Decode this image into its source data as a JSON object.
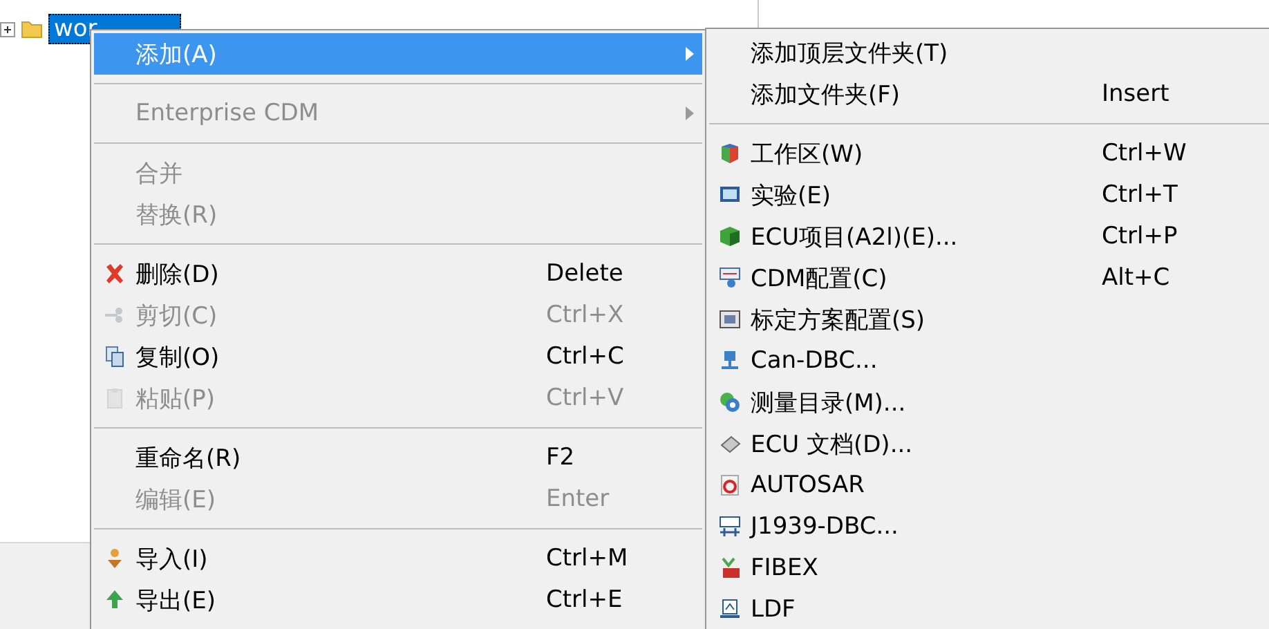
{
  "tree": {
    "items": [
      {
        "label": "wor",
        "selected": true,
        "expanded": false
      }
    ]
  },
  "context_menu": {
    "items": [
      {
        "kind": "item",
        "label": "添加(A)",
        "selected": true,
        "disabled": false,
        "submenu": true
      },
      {
        "kind": "separator"
      },
      {
        "kind": "item",
        "label": "Enterprise CDM",
        "selected": false,
        "disabled": true,
        "submenu": true
      },
      {
        "kind": "separator"
      },
      {
        "kind": "item",
        "label": "合并",
        "selected": false,
        "disabled": true,
        "submenu": false
      },
      {
        "kind": "item",
        "label": "替换(R)",
        "selected": false,
        "disabled": true,
        "submenu": false
      },
      {
        "kind": "separator"
      },
      {
        "kind": "item",
        "label": "删除(D)",
        "shortcut": "Delete",
        "selected": false,
        "disabled": false,
        "submenu": false
      },
      {
        "kind": "item",
        "label": "剪切(C)",
        "shortcut": "Ctrl+X",
        "selected": false,
        "disabled": true,
        "submenu": false
      },
      {
        "kind": "item",
        "label": "复制(O)",
        "shortcut": "Ctrl+C",
        "selected": false,
        "disabled": false,
        "submenu": false
      },
      {
        "kind": "item",
        "label": "粘贴(P)",
        "shortcut": "Ctrl+V",
        "selected": false,
        "disabled": true,
        "submenu": false
      },
      {
        "kind": "separator"
      },
      {
        "kind": "item",
        "label": "重命名(R)",
        "shortcut": "F2",
        "selected": false,
        "disabled": false,
        "submenu": false
      },
      {
        "kind": "item",
        "label": "编辑(E)",
        "shortcut": "Enter",
        "selected": false,
        "disabled": true,
        "submenu": false
      },
      {
        "kind": "separator"
      },
      {
        "kind": "item",
        "label": "导入(I)",
        "shortcut": "Ctrl+M",
        "selected": false,
        "disabled": false,
        "submenu": false
      },
      {
        "kind": "item",
        "label": "导出(E)",
        "shortcut": "Ctrl+E",
        "selected": false,
        "disabled": false,
        "submenu": false
      }
    ]
  },
  "submenu": {
    "items": [
      {
        "kind": "item",
        "label": "添加顶层文件夹(T)",
        "selected": false,
        "disabled": false
      },
      {
        "kind": "item",
        "label": "添加文件夹(F)",
        "shortcut": "Insert",
        "selected": false,
        "disabled": false
      },
      {
        "kind": "separator"
      },
      {
        "kind": "item",
        "label": "工作区(W)",
        "shortcut": "Ctrl+W",
        "selected": false,
        "disabled": false
      },
      {
        "kind": "item",
        "label": "实验(E)",
        "shortcut": "Ctrl+T",
        "selected": false,
        "disabled": false
      },
      {
        "kind": "item",
        "label": "ECU项目(A2l)(E)...",
        "shortcut": "Ctrl+P",
        "selected": false,
        "disabled": false
      },
      {
        "kind": "item",
        "label": "CDM配置(C)",
        "shortcut": "Alt+C",
        "selected": false,
        "disabled": false
      },
      {
        "kind": "item",
        "label": "标定方案配置(S)",
        "selected": false,
        "disabled": false
      },
      {
        "kind": "item",
        "label": "Can-DBC...",
        "selected": false,
        "disabled": false
      },
      {
        "kind": "item",
        "label": "测量目录(M)...",
        "selected": false,
        "disabled": false
      },
      {
        "kind": "item",
        "label": "ECU 文档(D)...",
        "selected": false,
        "disabled": false
      },
      {
        "kind": "item",
        "label": "AUTOSAR",
        "selected": false,
        "disabled": false
      },
      {
        "kind": "item",
        "label": "J1939-DBC...",
        "selected": false,
        "disabled": false
      },
      {
        "kind": "item",
        "label": "FIBEX",
        "selected": false,
        "disabled": false
      },
      {
        "kind": "item",
        "label": "LDF",
        "selected": false,
        "disabled": false
      }
    ]
  }
}
